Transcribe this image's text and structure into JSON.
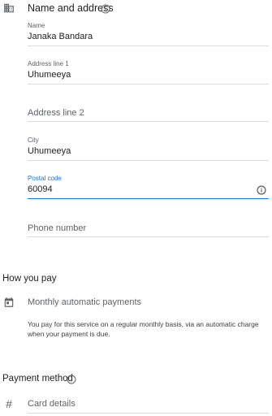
{
  "address": {
    "title": "Name and address",
    "fields": {
      "name": {
        "label": "Name",
        "value": "Janaka Bandara"
      },
      "address1": {
        "label": "Address line 1",
        "value": "Uhumeeya"
      },
      "address2": {
        "placeholder": "Address line 2"
      },
      "city": {
        "label": "City",
        "value": "Uhumeeya"
      },
      "postal": {
        "label": "Postal code",
        "value": "60094"
      },
      "phone": {
        "placeholder": "Phone number"
      }
    }
  },
  "how_you_pay": {
    "title": "How you pay",
    "option": "Monthly automatic payments",
    "description": "You pay for this service on a regular monthly basis, via an automatic charge when your payment is due."
  },
  "payment_method": {
    "title": "Payment method",
    "card_placeholder": "Card details"
  },
  "colors": {
    "accent": "#1a73e8",
    "divider": "#dadce0",
    "icon": "#5f6368"
  },
  "icons": [
    "building-icon",
    "info-icon",
    "calendar-icon",
    "hash-icon"
  ]
}
